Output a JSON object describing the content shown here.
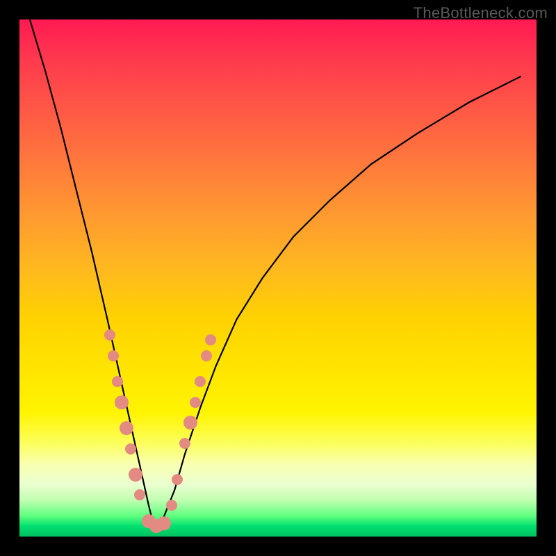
{
  "watermark": "TheBottleneck.com",
  "colors": {
    "marker": "#e38a82",
    "curve": "#000000",
    "background_top": "#ff1a52",
    "background_bottom": "#00c060"
  },
  "chart_data": {
    "type": "line",
    "title": "",
    "xlabel": "",
    "ylabel": "",
    "xlim": [
      0,
      100
    ],
    "ylim": [
      0,
      100
    ],
    "grid": false,
    "note": "V-shaped bottleneck curve. x is relative horizontal position (0=left, 100=right). y is relative vertical position (0=bottom/green, 100=top/red). Lower y = better/less bottleneck. Minimum near x≈26.",
    "series": [
      {
        "name": "curve",
        "x": [
          2,
          5,
          8,
          11,
          14,
          17,
          19,
          21,
          23,
          25,
          26,
          27,
          28,
          30,
          32,
          35,
          38,
          42,
          47,
          53,
          60,
          68,
          77,
          87,
          97
        ],
        "y": [
          100,
          90,
          79,
          67,
          55,
          42,
          33,
          24,
          15,
          6,
          2,
          2,
          4,
          9,
          16,
          25,
          33,
          42,
          50,
          58,
          65,
          72,
          78,
          84,
          89
        ]
      }
    ],
    "markers": {
      "name": "data-points",
      "note": "Salmon-colored circular markers clustered near the bottom of the V.",
      "points": [
        {
          "x": 17.5,
          "y": 39,
          "size": "normal"
        },
        {
          "x": 18.2,
          "y": 35,
          "size": "normal"
        },
        {
          "x": 19.0,
          "y": 30,
          "size": "normal"
        },
        {
          "x": 19.8,
          "y": 26,
          "size": "big"
        },
        {
          "x": 20.7,
          "y": 21,
          "size": "big"
        },
        {
          "x": 21.5,
          "y": 17,
          "size": "normal"
        },
        {
          "x": 22.5,
          "y": 12,
          "size": "big"
        },
        {
          "x": 23.3,
          "y": 8,
          "size": "normal"
        },
        {
          "x": 25.0,
          "y": 3,
          "size": "big"
        },
        {
          "x": 26.5,
          "y": 2,
          "size": "big"
        },
        {
          "x": 28.0,
          "y": 2.5,
          "size": "big"
        },
        {
          "x": 29.5,
          "y": 6,
          "size": "normal"
        },
        {
          "x": 30.5,
          "y": 11,
          "size": "normal"
        },
        {
          "x": 32.0,
          "y": 18,
          "size": "normal"
        },
        {
          "x": 33.0,
          "y": 22,
          "size": "big"
        },
        {
          "x": 34.0,
          "y": 26,
          "size": "normal"
        },
        {
          "x": 35.0,
          "y": 30,
          "size": "normal"
        },
        {
          "x": 36.2,
          "y": 35,
          "size": "normal"
        },
        {
          "x": 37.0,
          "y": 38,
          "size": "normal"
        }
      ]
    }
  }
}
